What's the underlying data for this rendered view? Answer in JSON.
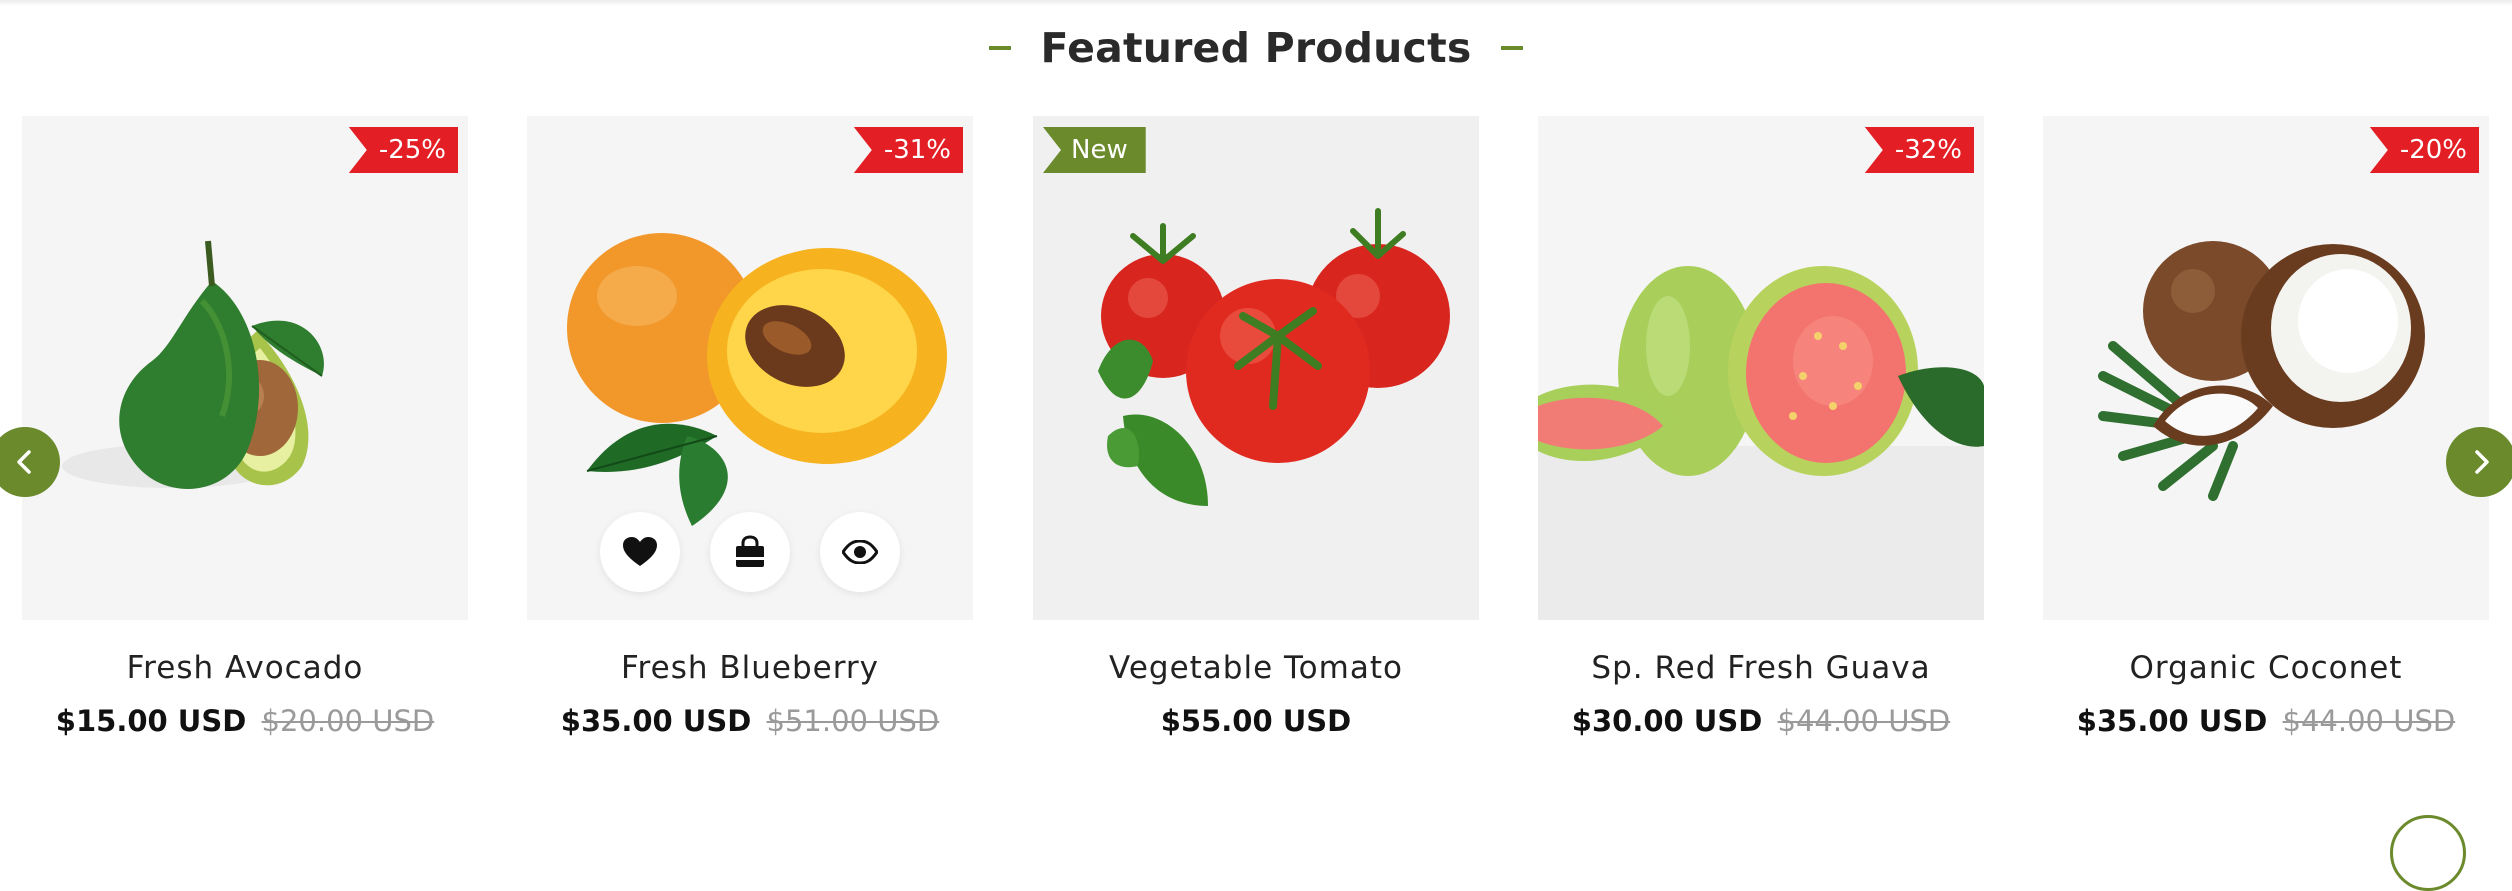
{
  "section": {
    "title": "Featured Products"
  },
  "products": [
    {
      "name": "Fresh Avocado",
      "price": "$15.00 USD",
      "old_price": "$20.00 USD",
      "badge": "-25%",
      "image_icon": "avocado-image"
    },
    {
      "name": "Fresh Blueberry",
      "price": "$35.00 USD",
      "old_price": "$51.00 USD",
      "badge": "-31%",
      "image_icon": "apricot-image"
    },
    {
      "name": "Vegetable Tomato",
      "price": "$55.00 USD",
      "old_price": "",
      "badge": "New",
      "image_icon": "tomato-image"
    },
    {
      "name": "Sp. Red Fresh Guava",
      "price": "$30.00 USD",
      "old_price": "$44.00 USD",
      "badge": "-32%",
      "image_icon": "guava-image"
    },
    {
      "name": "Organic Coconet",
      "price": "$35.00 USD",
      "old_price": "$44.00 USD",
      "badge": "-20%",
      "image_icon": "coconut-image"
    }
  ],
  "hover_actions": [
    "heart-icon",
    "shopping-bag-icon",
    "eye-icon"
  ],
  "navigation": {
    "prev_icon": "chevron-left-icon",
    "next_icon": "chevron-right-icon"
  },
  "colors": {
    "accent": "#6b8a2b",
    "sale": "#e31e24",
    "new": "#6b8a2b",
    "text": "#222222",
    "muted": "#9a9a9a",
    "card_bg": "#f5f5f5"
  }
}
